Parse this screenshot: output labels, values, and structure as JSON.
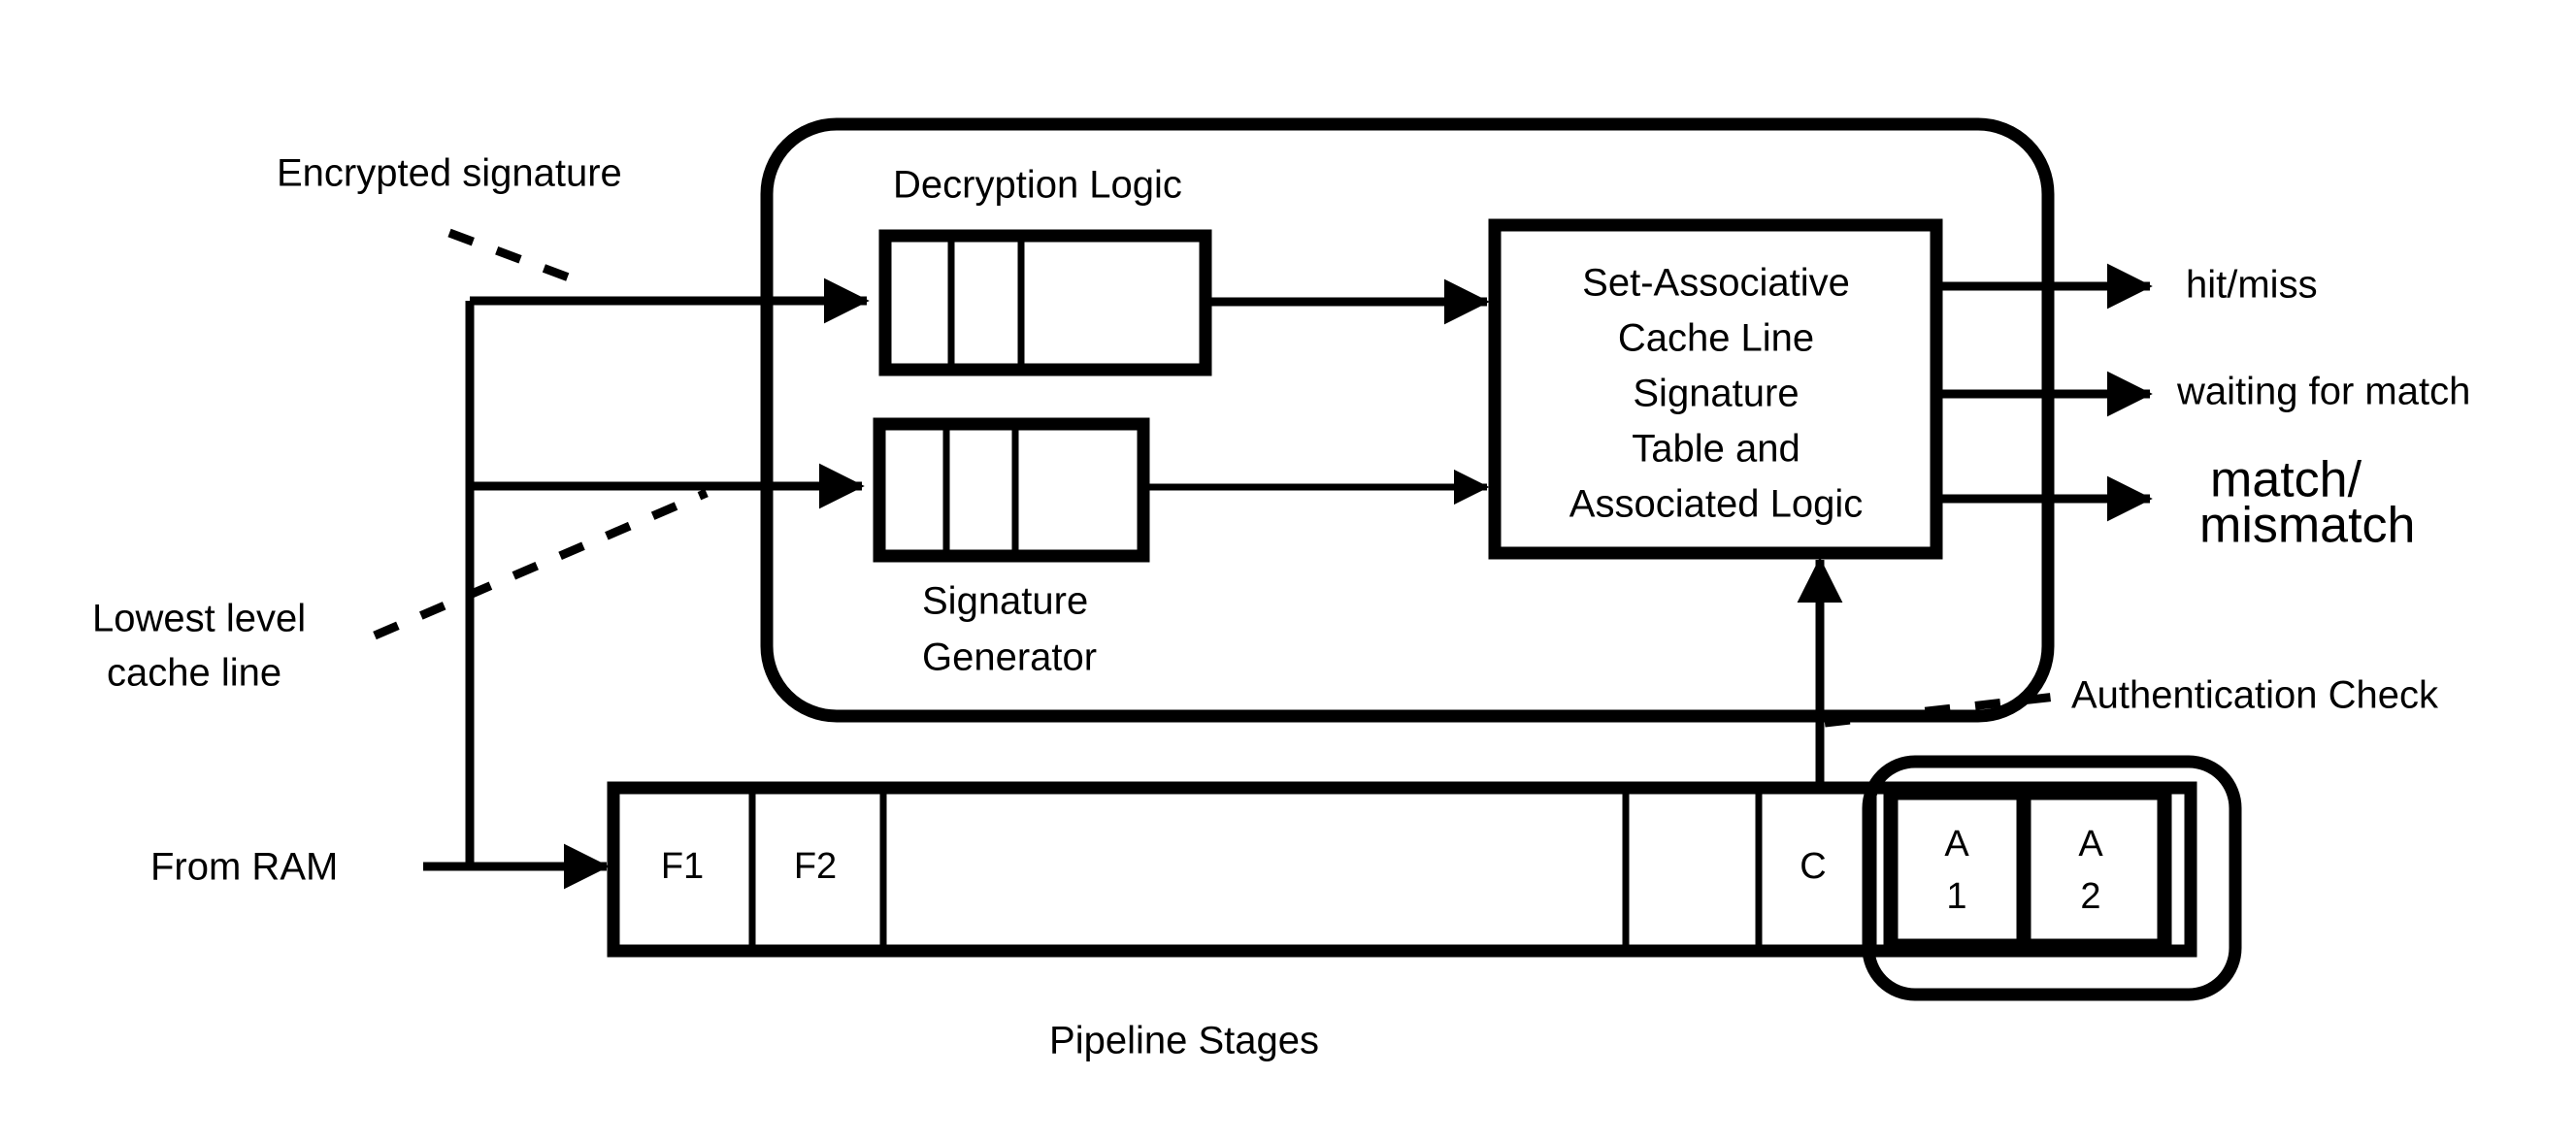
{
  "diagram": {
    "title_label": "Pipeline Stages",
    "annotations": {
      "encrypted_signature": "Encrypted signature",
      "lowest_level_cache_line_line1": "Lowest level",
      "lowest_level_cache_line_line2": "cache line",
      "from_ram": "From RAM",
      "authentication_check": "Authentication Check"
    },
    "decryption_module": {
      "label": "Decryption Logic",
      "signature_generator_line1": "Signature",
      "signature_generator_line2": "Generator"
    },
    "table_block": {
      "line1": "Set-Associative",
      "line2": "Cache Line",
      "line3": "Signature",
      "line4": "Table and",
      "line5": "Associated Logic"
    },
    "outputs": [
      {
        "label": "hit/miss"
      },
      {
        "label": "waiting for match"
      },
      {
        "label": "match/",
        "label2": "mismatch"
      }
    ],
    "pipeline_stages": [
      {
        "label": "F1"
      },
      {
        "label": "F2"
      },
      {
        "label": ""
      },
      {
        "label": ""
      },
      {
        "label": "C"
      }
    ],
    "auth_stages": [
      {
        "label_top": "A",
        "label_bottom": "1"
      },
      {
        "label_top": "A",
        "label_bottom": "2"
      }
    ],
    "colors": {
      "ink": "#000000",
      "background": "#ffffff"
    }
  }
}
